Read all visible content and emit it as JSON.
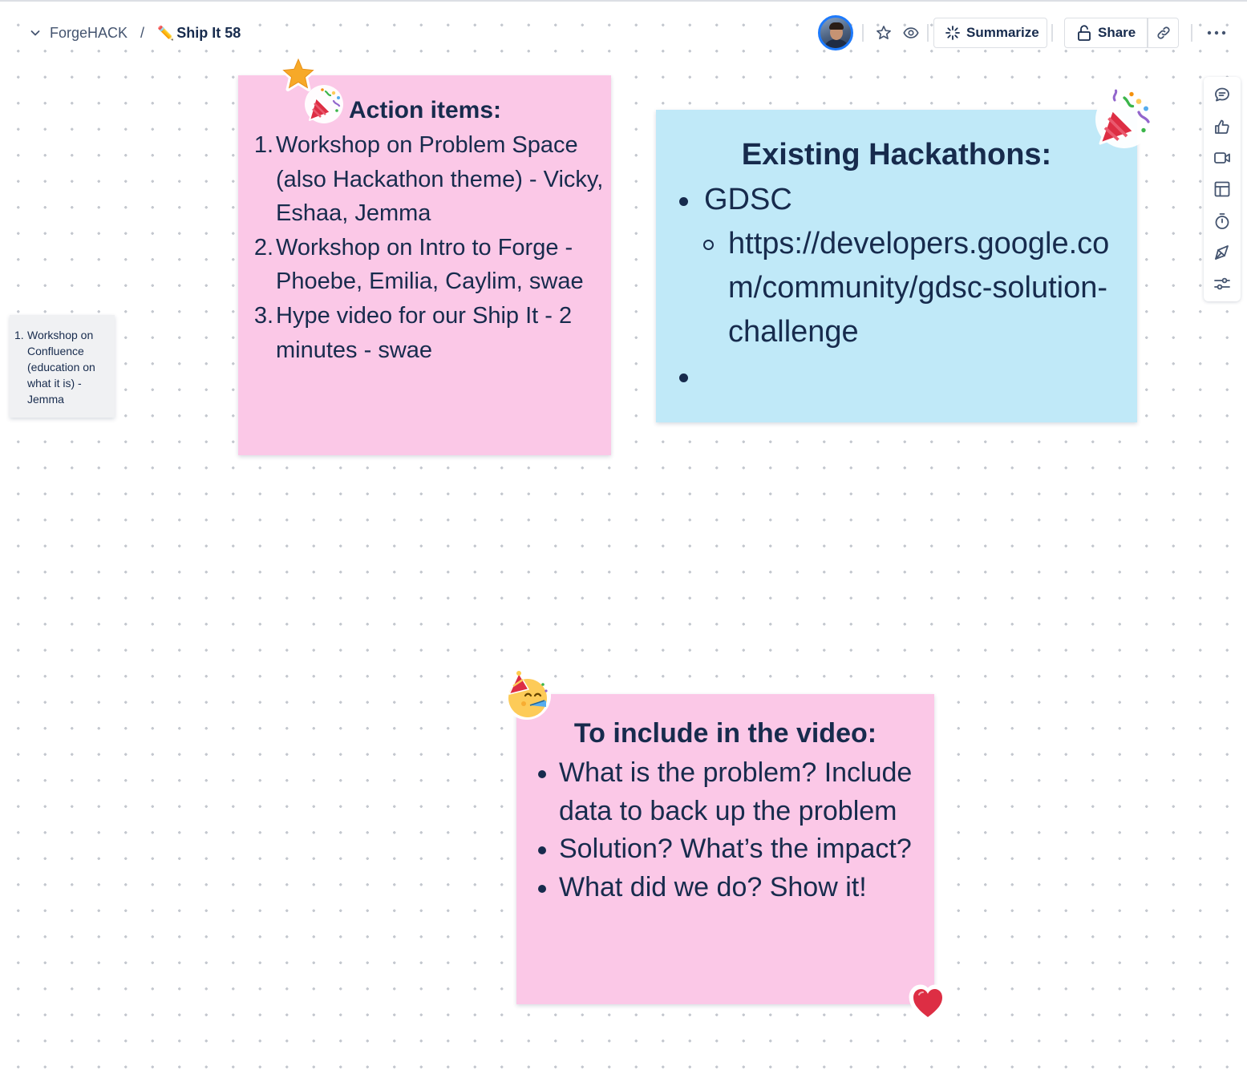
{
  "breadcrumb": {
    "space": "ForgeHACK",
    "separator": "/",
    "page_emoji": "✏️",
    "page_title": "Ship It 58"
  },
  "header": {
    "summarize_label": "Summarize",
    "share_label": "Share"
  },
  "colors": {
    "pink_note": "#fbc8e7",
    "blue_note": "#c0e9f8",
    "gray_note": "#f0f1f3",
    "text": "#172b4d",
    "avatar_ring": "#1d7afc"
  },
  "toolbar": {
    "icons": [
      "comment-icon",
      "thumbs-up-icon",
      "video-icon",
      "template-icon",
      "timer-icon",
      "pen-icon",
      "settings-sliders-icon"
    ]
  },
  "notes": {
    "action_items": {
      "title": "Action items:",
      "items": [
        {
          "num": "1.",
          "text": "Workshop on Problem Space (also Hackathon theme) - Vicky, Eshaa, Jemma"
        },
        {
          "num": "2.",
          "text": "Workshop on Intro to Forge - Phoebe, Emilia, Caylim, swae"
        },
        {
          "num": "3.",
          "text": "Hype video for our Ship It - 2 minutes - swae"
        }
      ]
    },
    "existing_hackathons": {
      "title": "Existing Hackathons:",
      "items": [
        {
          "text": "GDSC",
          "sub": "https://developers.google.com/community/gdsc-solution-challenge"
        },
        {
          "text": ""
        }
      ]
    },
    "video": {
      "title": "To include in the video:",
      "items": [
        "What is the problem? Include data to back up the problem",
        "Solution? What’s the impact?",
        "What did we do? Show it!"
      ]
    },
    "confluence": {
      "num": "1.",
      "text": "Workshop on Confluence (education on what it is) - Jemma"
    }
  },
  "stickers": [
    "star-sticker",
    "party-popper-sticker",
    "party-popper-sticker",
    "partying-face-sticker",
    "heart-sticker"
  ]
}
